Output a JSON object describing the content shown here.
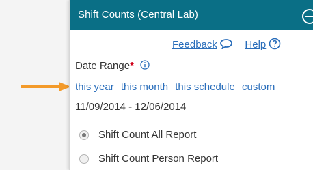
{
  "header": {
    "title": "Shift Counts (Central Lab)"
  },
  "top_links": {
    "feedback": "Feedback",
    "help": "Help"
  },
  "date_range": {
    "label": "Date Range",
    "required_mark": "*",
    "options": [
      "this year",
      "this month",
      "this schedule",
      "custom"
    ],
    "value": "11/09/2014 - 12/06/2014"
  },
  "reports": [
    {
      "label": "Shift Count All Report",
      "selected": true
    },
    {
      "label": "Shift Count Person Report",
      "selected": false
    }
  ],
  "colors": {
    "header_bg": "#0a6f86",
    "link": "#2a6ebb",
    "arrow": "#f39a2a",
    "required": "#d0021b"
  },
  "icons": [
    "collapse-icon",
    "feedback-icon",
    "help-icon",
    "info-icon",
    "arrow-icon"
  ]
}
